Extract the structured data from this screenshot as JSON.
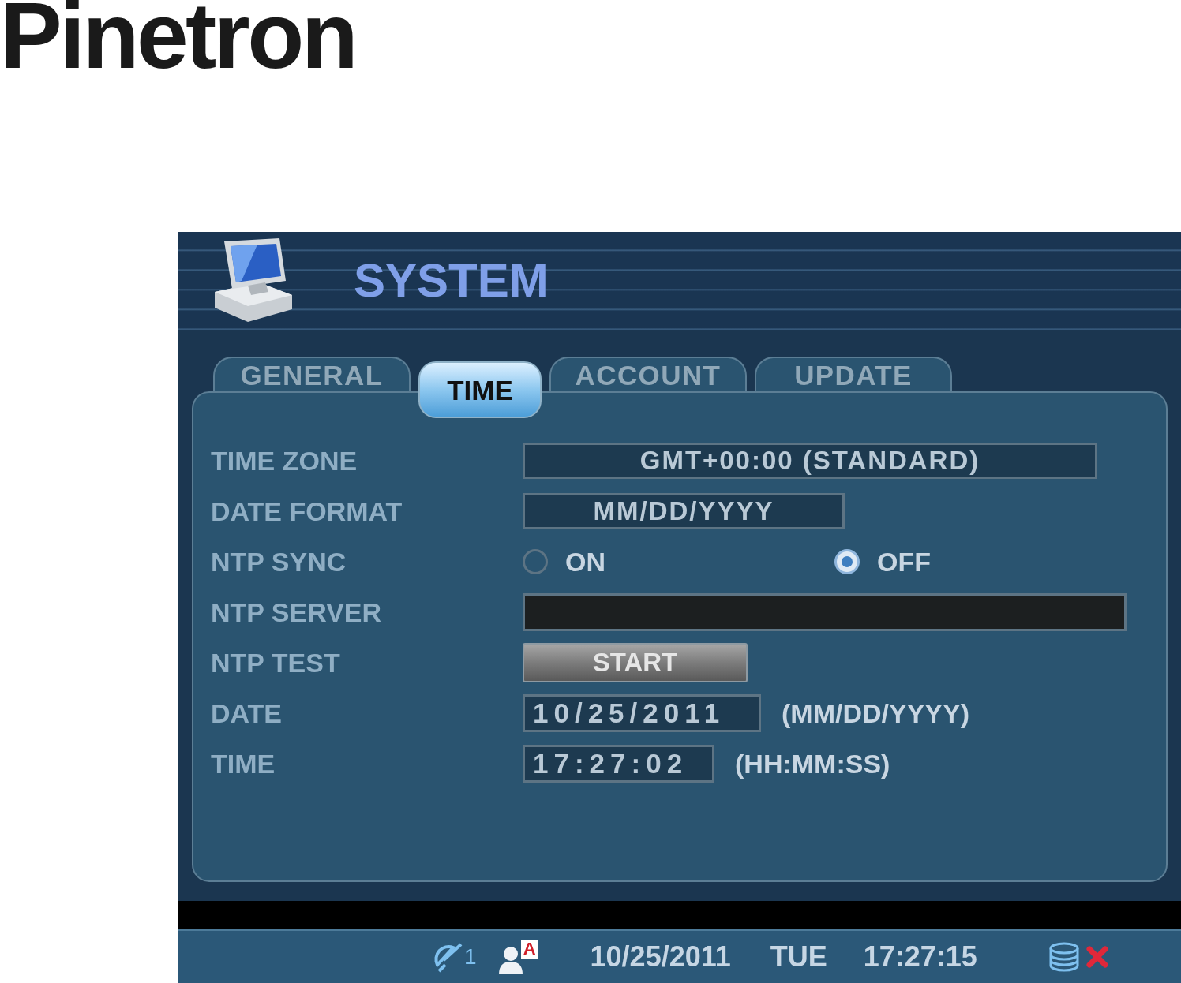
{
  "logo": {
    "text": "Pinetron"
  },
  "window": {
    "title": "SYSTEM"
  },
  "tabs": [
    {
      "label": "GENERAL",
      "selected": false
    },
    {
      "label": "TIME",
      "selected": true
    },
    {
      "label": "ACCOUNT",
      "selected": false
    },
    {
      "label": "UPDATE",
      "selected": false
    }
  ],
  "fields": [
    {
      "kind": "select",
      "label": "TIME ZONE",
      "value": "GMT+00:00 (STANDARD)"
    },
    {
      "kind": "select",
      "label": "DATE FORMAT",
      "value": "MM/DD/YYYY"
    },
    {
      "kind": "radio",
      "label": "NTP SYNC",
      "options": [
        {
          "label": "ON",
          "selected": false
        },
        {
          "label": "OFF",
          "selected": true
        }
      ]
    },
    {
      "kind": "input",
      "label": "NTP SERVER"
    },
    {
      "kind": "button",
      "label": "NTP TEST",
      "button": "START"
    },
    {
      "kind": "spin",
      "label": "DATE",
      "value": "10/25/2011",
      "hint": "(MM/DD/YYYY)"
    },
    {
      "kind": "spin",
      "label": "TIME",
      "value": "17:27:02",
      "hint": "(HH:MM:SS)"
    }
  ],
  "status_bar": {
    "camera_count": "1",
    "user_badge": "A",
    "date": "10/25/2011",
    "day": "TUE",
    "time": "17:27:15"
  }
}
